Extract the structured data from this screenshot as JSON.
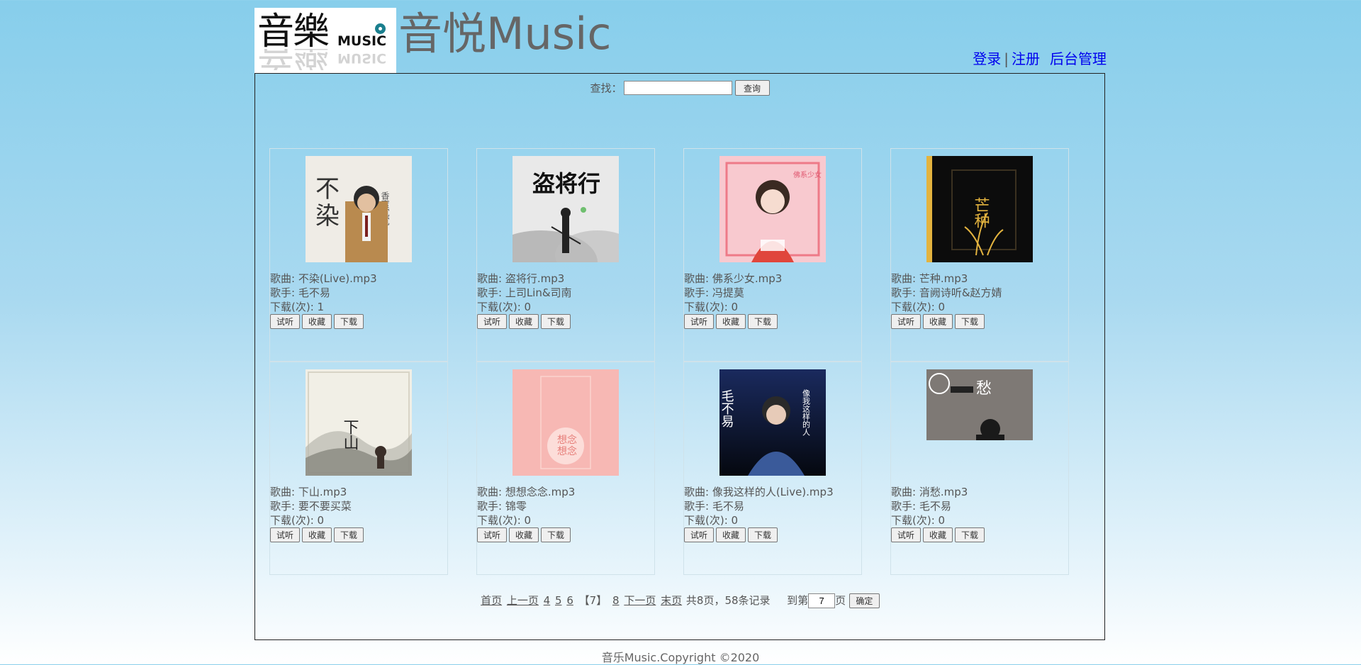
{
  "header": {
    "logo": {
      "glyph": "音樂",
      "word": "MUSIC"
    },
    "site_title": "音悦Music",
    "links": {
      "login": "登录",
      "separator": "|",
      "register": "注册",
      "admin": "后台管理"
    }
  },
  "search": {
    "label": "查找：",
    "value": "",
    "placeholder": "",
    "button": "查询"
  },
  "labels": {
    "song": "歌曲: ",
    "singer": "歌手: ",
    "downloads": "下载(次): "
  },
  "buttons": {
    "listen": "试听",
    "favorite": "收藏",
    "download": "下载"
  },
  "songs": [
    {
      "title": "不染(Live).mp3",
      "singer": "毛不易",
      "downloads": "1",
      "cover": "cover-bu-ran"
    },
    {
      "title": "盗将行.mp3",
      "singer": "上司Lin&司南",
      "downloads": "0",
      "cover": "cover-dao-jiang-xing"
    },
    {
      "title": "佛系少女.mp3",
      "singer": "冯提莫",
      "downloads": "0",
      "cover": "cover-fo-xi-shao-nv"
    },
    {
      "title": "芒种.mp3",
      "singer": "音阙诗听&赵方婧",
      "downloads": "0",
      "cover": "cover-mang-zhong"
    },
    {
      "title": "下山.mp3",
      "singer": "要不要买菜",
      "downloads": "0",
      "cover": "cover-xia-shan"
    },
    {
      "title": "想想念念.mp3",
      "singer": "锦零",
      "downloads": "0",
      "cover": "cover-xiang-xiang-nian-nian"
    },
    {
      "title": "像我这样的人(Live).mp3",
      "singer": "毛不易",
      "downloads": "0",
      "cover": "cover-xiang-wo-zhe-yang-de-ren"
    },
    {
      "title": "消愁.mp3",
      "singer": "毛不易",
      "downloads": "0",
      "cover": "cover-xiao-chou"
    }
  ],
  "pager": {
    "first": "首页",
    "prev": "上一页",
    "pages": [
      "4",
      "5",
      "6"
    ],
    "current": "【7】",
    "next_pages": [
      "8"
    ],
    "next": "下一页",
    "last": "末页",
    "summary": "共8页，58条记录",
    "goto_prefix": "到第",
    "goto_value": "7",
    "goto_suffix": "页",
    "confirm": "确定"
  },
  "footer": {
    "copyright": "音乐Music.Copyright ©2020"
  }
}
